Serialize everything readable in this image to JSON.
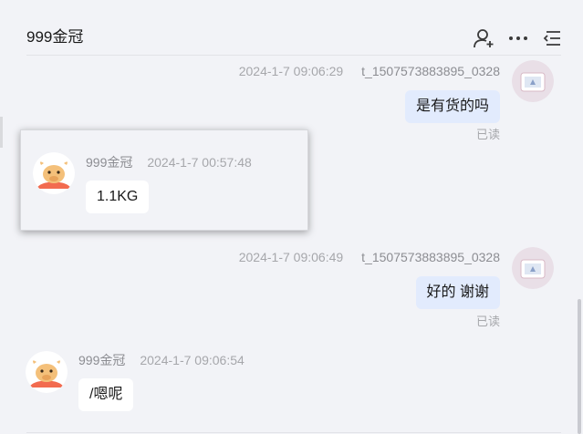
{
  "header": {
    "title": "999金冠",
    "icons": [
      "add-member-icon",
      "more-icon",
      "menu-icon"
    ]
  },
  "messages": [
    {
      "id": 1,
      "side": "right",
      "time": "2024-1-7 09:06:29",
      "sender": "t_1507573883895_0328",
      "text": "是有货的吗",
      "status": "已读"
    },
    {
      "id": 2,
      "side": "left",
      "sender": "999金冠",
      "time": "2024-1-7 00:57:48",
      "text": "1.1KG",
      "quoted": true
    },
    {
      "id": 3,
      "side": "right",
      "time": "2024-1-7 09:06:49",
      "sender": "t_1507573883895_0328",
      "text": "好的 谢谢",
      "status": "已读"
    },
    {
      "id": 4,
      "side": "left",
      "sender": "999金冠",
      "time": "2024-1-7 09:06:54",
      "text": "/嗯呢"
    }
  ],
  "colors": {
    "background": "#f2f3f7",
    "my_bubble": "#e2ebfd",
    "their_bubble": "#ffffff",
    "meta_text": "#a6a7ab"
  }
}
